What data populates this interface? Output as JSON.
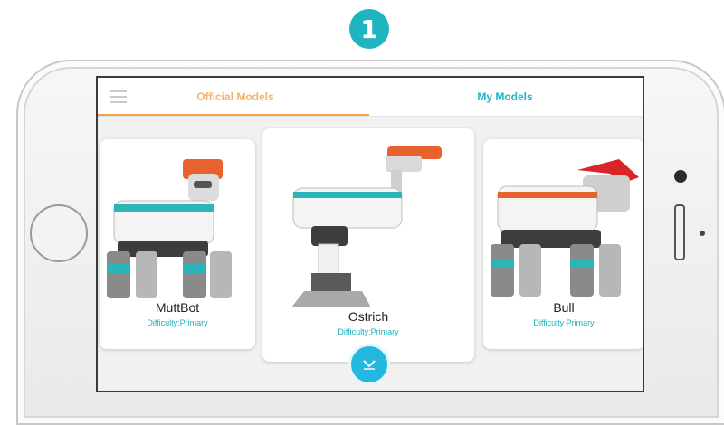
{
  "step": {
    "number": "1"
  },
  "tabs": {
    "official": "Official Models",
    "mine": "My Models",
    "active": "Official Models"
  },
  "models": [
    {
      "name": "MuttBot",
      "difficulty": "Difficulty:Primary"
    },
    {
      "name": "Ostrich",
      "difficulty": "Difficulty:Primary"
    },
    {
      "name": "Bull",
      "difficulty": "Difficulty Primary"
    }
  ],
  "icons": {
    "menu": "hamburger-menu-icon",
    "scroll": "chevron-down-icon"
  },
  "colors": {
    "accent_teal": "#1cb6c4",
    "active_tab": "#f5a24b",
    "scroll_button": "#22b8e0",
    "difficulty_text": "#16b3b9"
  }
}
